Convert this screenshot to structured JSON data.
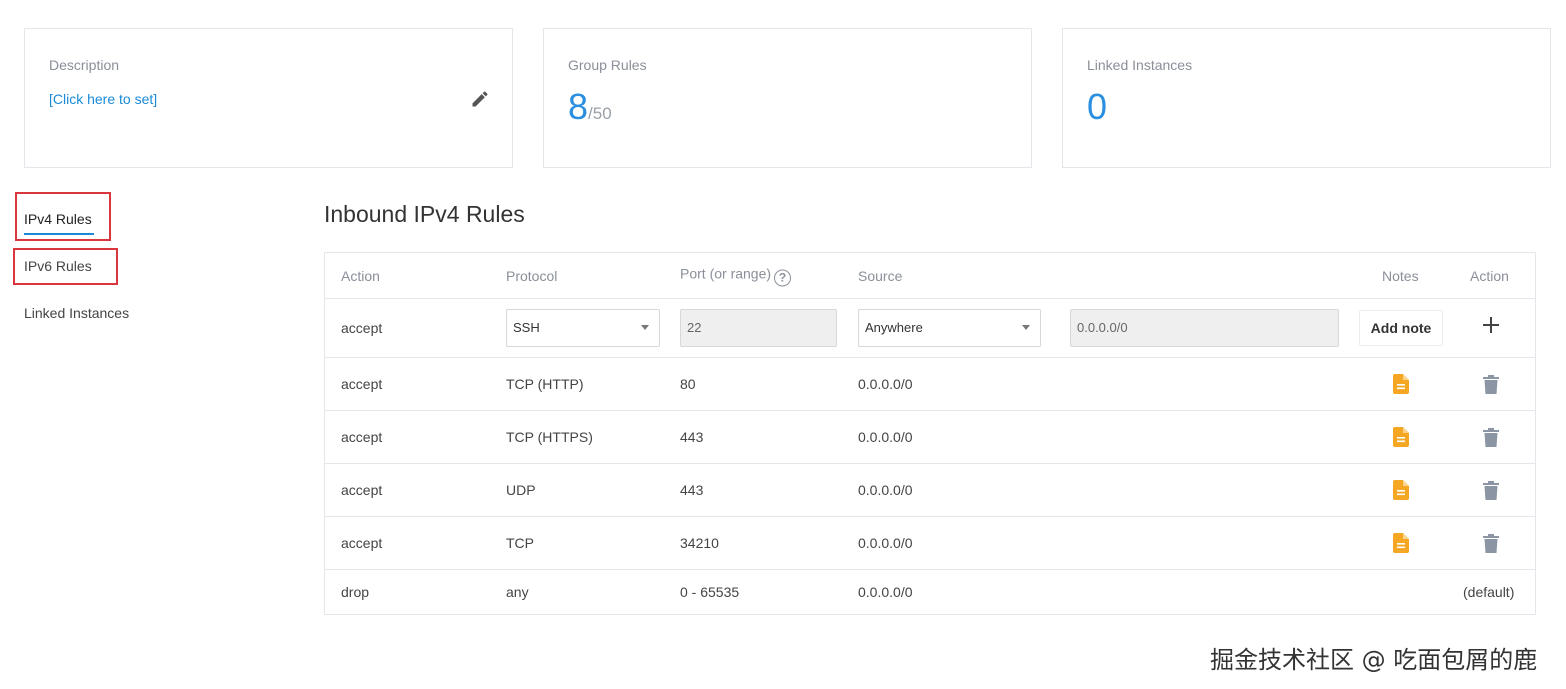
{
  "cards": {
    "description": {
      "label": "Description",
      "link": "[Click here to set]"
    },
    "group_rules": {
      "label": "Group Rules",
      "value": "8",
      "max": "/50"
    },
    "linked_instances": {
      "label": "Linked Instances",
      "value": "0"
    }
  },
  "sidebar": {
    "items": [
      {
        "label": "IPv4 Rules",
        "active": true
      },
      {
        "label": "IPv6 Rules",
        "active": false
      },
      {
        "label": "Linked Instances",
        "active": false
      }
    ]
  },
  "section_title": "Inbound IPv4 Rules",
  "table": {
    "headers": {
      "action": "Action",
      "protocol": "Protocol",
      "port": "Port (or range)",
      "help": "?",
      "source": "Source",
      "notes": "Notes",
      "action_col": "Action"
    },
    "new_rule": {
      "action": "accept",
      "protocol": "SSH",
      "port": "22",
      "source": "Anywhere",
      "source_ip": "0.0.0.0/0",
      "add_note_label": "Add note"
    },
    "rows": [
      {
        "action": "accept",
        "protocol": "TCP (HTTP)",
        "port": "80",
        "source": "0.0.0.0/0"
      },
      {
        "action": "accept",
        "protocol": "TCP (HTTPS)",
        "port": "443",
        "source": "0.0.0.0/0"
      },
      {
        "action": "accept",
        "protocol": "UDP",
        "port": "443",
        "source": "0.0.0.0/0"
      },
      {
        "action": "accept",
        "protocol": "TCP",
        "port": "34210",
        "source": "0.0.0.0/0"
      }
    ],
    "default_row": {
      "action": "drop",
      "protocol": "any",
      "port": "0 - 65535",
      "source": "0.0.0.0/0",
      "label": "(default)"
    }
  },
  "icons": {
    "edit": "pencil-icon",
    "add": "plus-icon",
    "note": "note-icon",
    "delete": "trash-icon",
    "dropdown": "caret-down-icon"
  },
  "colors": {
    "accent": "#1a8ad8",
    "highlight_box": "#d9363e",
    "note_icon": "#f5a623",
    "trash_icon": "#8c95a3"
  },
  "watermark": "掘金技术社区 @ 吃面包屑的鹿"
}
